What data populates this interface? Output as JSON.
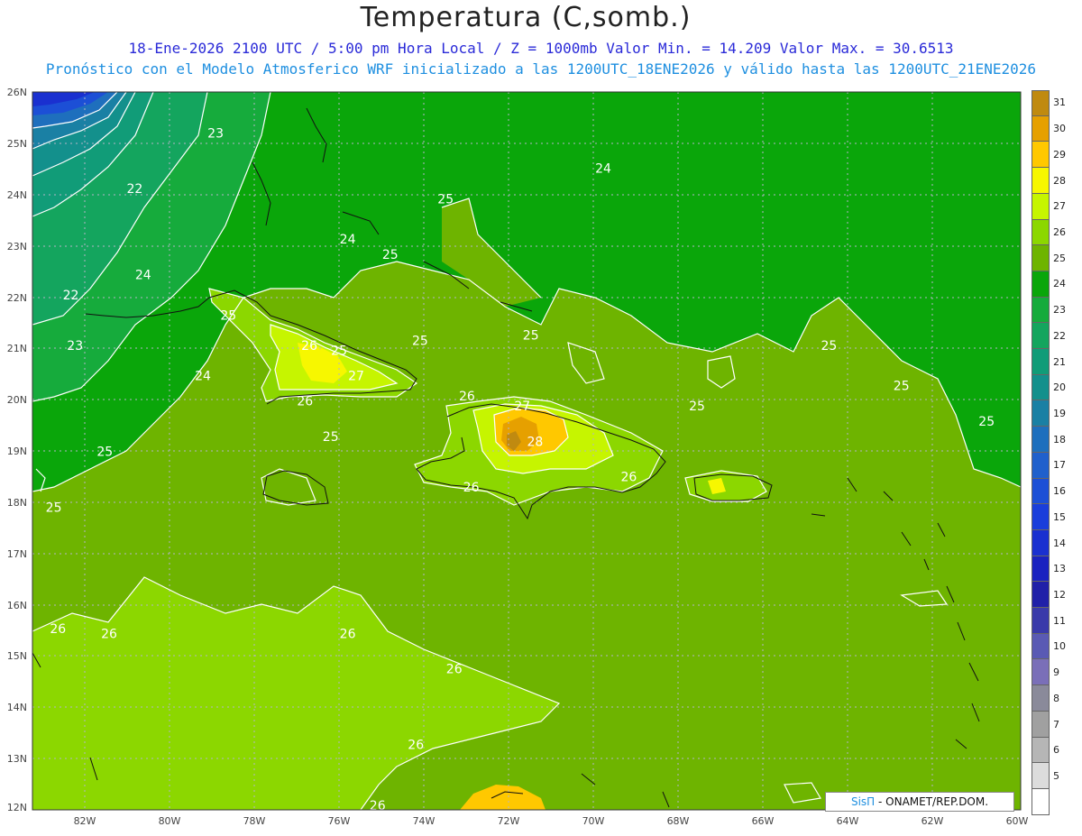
{
  "title": "Temperatura (C,somb.)",
  "subtitle1": "18-Ene-2026  2100 UTC / 5:00 pm Hora Local / Z = 1000mb    Valor Min. = 14.209  Valor Max. = 30.6513",
  "subtitle2": "Pronóstico con el Modelo Atmosferico WRF inicializado a las 1200UTC_18ENE2026 y válido hasta las  1200UTC_21ENE2026",
  "credit": {
    "brand": "SisΠ",
    "text": " - ONAMET/REP.DOM."
  },
  "lat_labels": [
    "26N",
    "25N",
    "24N",
    "23N",
    "22N",
    "21N",
    "20N",
    "19N",
    "18N",
    "17N",
    "16N",
    "15N",
    "14N",
    "13N",
    "12N"
  ],
  "lon_labels": [
    "82W",
    "80W",
    "78W",
    "76W",
    "74W",
    "72W",
    "70W",
    "68W",
    "66W",
    "64W",
    "62W",
    "60W"
  ],
  "legend": [
    {
      "label": "31",
      "color": "#c08a10"
    },
    {
      "label": "30",
      "color": "#e6a000"
    },
    {
      "label": "29",
      "color": "#ffc800"
    },
    {
      "label": "28",
      "color": "#f7f700"
    },
    {
      "label": "27",
      "color": "#c6f500"
    },
    {
      "label": "26",
      "color": "#8cd700"
    },
    {
      "label": "25",
      "color": "#6eb400"
    },
    {
      "label": "24",
      "color": "#0aa60a"
    },
    {
      "label": "23",
      "color": "#16ab3c"
    },
    {
      "label": "22",
      "color": "#14a55e"
    },
    {
      "label": "21",
      "color": "#119c78"
    },
    {
      "label": "20",
      "color": "#13908c"
    },
    {
      "label": "19",
      "color": "#1a80a4"
    },
    {
      "label": "18",
      "color": "#1e6fbd"
    },
    {
      "label": "17",
      "color": "#2060cc"
    },
    {
      "label": "16",
      "color": "#1c4fd6"
    },
    {
      "label": "15",
      "color": "#1a3edb"
    },
    {
      "label": "14",
      "color": "#1a30d0"
    },
    {
      "label": "13",
      "color": "#1a22c0"
    },
    {
      "label": "12",
      "color": "#2020a8"
    },
    {
      "label": "11",
      "color": "#3a3aaa"
    },
    {
      "label": "10",
      "color": "#5a5ab4"
    },
    {
      "label": "9",
      "color": "#7a6fb8"
    },
    {
      "label": "8",
      "color": "#8a8a9a"
    },
    {
      "label": "7",
      "color": "#a0a0a0"
    },
    {
      "label": "6",
      "color": "#b6b6b6"
    },
    {
      "label": "5",
      "color": "#dcdcdc"
    },
    {
      "label": "",
      "color": "#ffffff"
    }
  ],
  "contour_labels": [
    {
      "text": "23",
      "lon": -78.9,
      "lat": 25.3
    },
    {
      "text": "22",
      "lon": -80.8,
      "lat": 24.2
    },
    {
      "text": "24",
      "lon": -75.8,
      "lat": 23.2
    },
    {
      "text": "24",
      "lon": -80.6,
      "lat": 22.5
    },
    {
      "text": "22",
      "lon": -82.3,
      "lat": 22.1
    },
    {
      "text": "25",
      "lon": -74.8,
      "lat": 22.9
    },
    {
      "text": "25",
      "lon": -73.5,
      "lat": 24.0
    },
    {
      "text": "24",
      "lon": -69.8,
      "lat": 24.6
    },
    {
      "text": "25",
      "lon": -78.6,
      "lat": 21.7
    },
    {
      "text": "23",
      "lon": -82.2,
      "lat": 21.1
    },
    {
      "text": "24",
      "lon": -79.2,
      "lat": 20.5
    },
    {
      "text": "26",
      "lon": -76.7,
      "lat": 21.1
    },
    {
      "text": "25",
      "lon": -76.0,
      "lat": 21.0
    },
    {
      "text": "27",
      "lon": -75.6,
      "lat": 20.5
    },
    {
      "text": "25",
      "lon": -74.1,
      "lat": 21.2
    },
    {
      "text": "26",
      "lon": -76.8,
      "lat": 20.0
    },
    {
      "text": "25",
      "lon": -76.2,
      "lat": 19.3
    },
    {
      "text": "26",
      "lon": -73.0,
      "lat": 20.1
    },
    {
      "text": "27",
      "lon": -71.7,
      "lat": 19.9
    },
    {
      "text": "28",
      "lon": -71.4,
      "lat": 19.2
    },
    {
      "text": "26",
      "lon": -72.9,
      "lat": 18.3
    },
    {
      "text": "26",
      "lon": -69.2,
      "lat": 18.5
    },
    {
      "text": "25",
      "lon": -71.5,
      "lat": 21.3
    },
    {
      "text": "25",
      "lon": -67.6,
      "lat": 19.9
    },
    {
      "text": "25",
      "lon": -64.5,
      "lat": 21.1
    },
    {
      "text": "25",
      "lon": -62.8,
      "lat": 20.3
    },
    {
      "text": "25",
      "lon": -60.8,
      "lat": 19.6
    },
    {
      "text": "25",
      "lon": -81.5,
      "lat": 19.0
    },
    {
      "text": "25",
      "lon": -82.7,
      "lat": 17.9
    },
    {
      "text": "26",
      "lon": -82.6,
      "lat": 15.5
    },
    {
      "text": "26",
      "lon": -81.4,
      "lat": 15.4
    },
    {
      "text": "26",
      "lon": -75.8,
      "lat": 15.4
    },
    {
      "text": "26",
      "lon": -73.3,
      "lat": 14.7
    },
    {
      "text": "26",
      "lon": -74.2,
      "lat": 13.2
    },
    {
      "text": "26",
      "lon": -75.1,
      "lat": 12.0
    }
  ]
}
